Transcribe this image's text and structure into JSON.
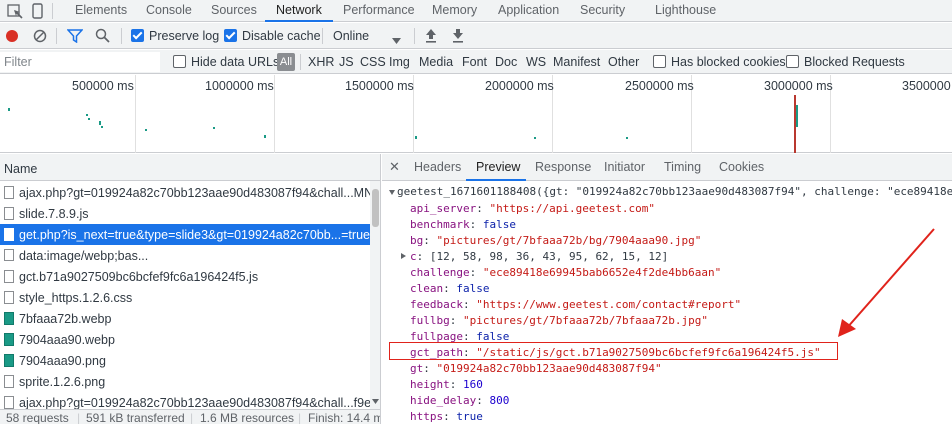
{
  "tabs": [
    "Elements",
    "Console",
    "Sources",
    "Network",
    "Performance",
    "Memory",
    "Application",
    "Security",
    "Lighthouse"
  ],
  "active_tab": "Network",
  "toolbar": {
    "preserve_log": "Preserve log",
    "disable_cache": "Disable cache",
    "throttle": "Online"
  },
  "filterbar": {
    "placeholder": "Filter",
    "hide_data_urls": "Hide data URLs",
    "all": "All",
    "types": [
      "XHR",
      "JS",
      "CSS",
      "Img",
      "Media",
      "Font",
      "Doc",
      "WS",
      "Manifest",
      "Other"
    ],
    "has_blocked_cookies": "Has blocked cookies",
    "blocked_requests": "Blocked Requests"
  },
  "overview": {
    "labels": [
      "500000 ms",
      "1000000 ms",
      "1500000 ms",
      "2000000 ms",
      "2500000 ms",
      "3000000 ms",
      "3500000 ("
    ]
  },
  "requests": {
    "header": "Name",
    "items": [
      {
        "name": "ajax.php?gt=019924a82c70bb123aae90d483087f94&chall...MNW...",
        "icon": "doc"
      },
      {
        "name": "slide.7.8.9.js",
        "icon": "doc"
      },
      {
        "name": "get.php?is_next=true&type=slide3&gt=019924a82c70bb...=true&...",
        "icon": "doc",
        "selected": true
      },
      {
        "name": "data:image/webp;bas...",
        "icon": "data"
      },
      {
        "name": "gct.b71a9027509bc6bcfef9fc6a196424f5.js",
        "icon": "doc"
      },
      {
        "name": "style_https.1.2.6.css",
        "icon": "doc"
      },
      {
        "name": "7bfaaa72b.webp",
        "icon": "img"
      },
      {
        "name": "7904aaa90.webp",
        "icon": "img"
      },
      {
        "name": "7904aaa90.png",
        "icon": "img"
      },
      {
        "name": "sprite.1.2.6.png",
        "icon": "doc"
      },
      {
        "name": "ajax.php?gt=019924a82c70bb123aae90d483087f94&chall...f9ee2f...",
        "icon": "doc"
      }
    ]
  },
  "status": {
    "requests": "58 requests",
    "transferred": "591 kB transferred",
    "resources": "1.6 MB resources",
    "finish": "Finish: 14.4 m"
  },
  "detail": {
    "tabs": [
      "Headers",
      "Preview",
      "Response",
      "Initiator",
      "Timing",
      "Cookies"
    ],
    "active": "Preview",
    "root": "geetest_1671601188408({gt: \"019924a82c70bb123aae90d483087f94\", challenge: \"ece89418e69",
    "lines": [
      {
        "key": "api_server",
        "value": "\"https://api.geetest.com\"",
        "type": "s"
      },
      {
        "key": "benchmark",
        "value": "false",
        "type": "b"
      },
      {
        "key": "bg",
        "value": "\"pictures/gt/7bfaaa72b/bg/7904aaa90.jpg\"",
        "type": "s"
      },
      {
        "key": "c",
        "value": "[12, 58, 98, 36, 43, 95, 62, 15, 12]",
        "type": "p",
        "expandable": true
      },
      {
        "key": "challenge",
        "value": "\"ece89418e69945bab6652e4f2de4bb6aan\"",
        "type": "s"
      },
      {
        "key": "clean",
        "value": "false",
        "type": "b"
      },
      {
        "key": "feedback",
        "value": "\"https://www.geetest.com/contact#report\"",
        "type": "s"
      },
      {
        "key": "fullbg",
        "value": "\"pictures/gt/7bfaaa72b/7bfaaa72b.jpg\"",
        "type": "s"
      },
      {
        "key": "fullpage",
        "value": "false",
        "type": "b"
      },
      {
        "key": "gct_path",
        "value": "\"/static/js/gct.b71a9027509bc6bcfef9fc6a196424f5.js\"",
        "type": "s"
      },
      {
        "key": "gt",
        "value": "\"019924a82c70bb123aae90d483087f94\"",
        "type": "s"
      },
      {
        "key": "height",
        "value": "160",
        "type": "n"
      },
      {
        "key": "hide_delay",
        "value": "800",
        "type": "n"
      },
      {
        "key": "https",
        "value": "true",
        "type": "b"
      }
    ]
  }
}
